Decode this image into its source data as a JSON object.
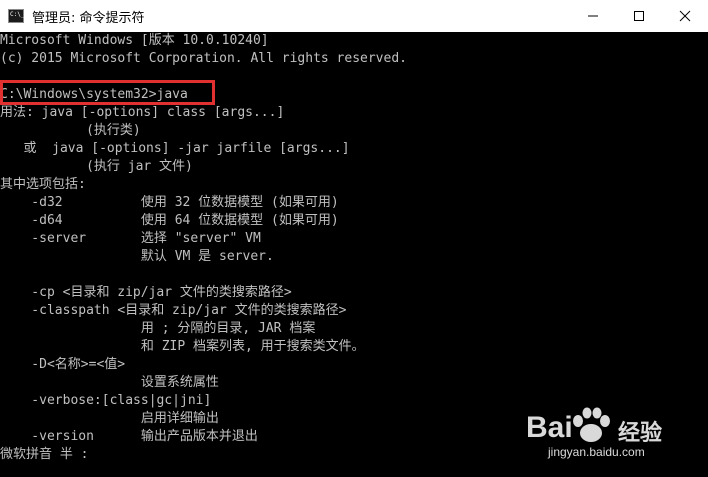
{
  "window": {
    "title": "管理员: 命令提示符",
    "buttons": {
      "minimize": "minimize",
      "maximize": "maximize",
      "close": "close"
    }
  },
  "console": {
    "lines": [
      "Microsoft Windows [版本 10.0.10240]",
      "(c) 2015 Microsoft Corporation. All rights reserved.",
      "",
      "C:\\Windows\\system32>java",
      "用法: java [-options] class [args...]",
      "           (执行类)",
      "   或  java [-options] -jar jarfile [args...]",
      "           (执行 jar 文件)",
      "其中选项包括:",
      "    -d32          使用 32 位数据模型 (如果可用)",
      "    -d64          使用 64 位数据模型 (如果可用)",
      "    -server       选择 \"server\" VM",
      "                  默认 VM 是 server.",
      "",
      "    -cp <目录和 zip/jar 文件的类搜索路径>",
      "    -classpath <目录和 zip/jar 文件的类搜索路径>",
      "                  用 ; 分隔的目录, JAR 档案",
      "                  和 ZIP 档案列表, 用于搜索类文件。",
      "    -D<名称>=<值>",
      "                  设置系统属性",
      "    -verbose:[class|gc|jni]",
      "                  启用详细输出",
      "    -version      输出产品版本并退出",
      "微软拼音 半 :"
    ]
  },
  "watermark": {
    "brand": "Bai",
    "brand_suffix": "经验",
    "url": "jingyan.baidu.com"
  },
  "colors": {
    "console_bg": "#000000",
    "console_fg": "#c0c0c0",
    "highlight_box": "#e03030",
    "titlebar_bg": "#ffffff"
  }
}
